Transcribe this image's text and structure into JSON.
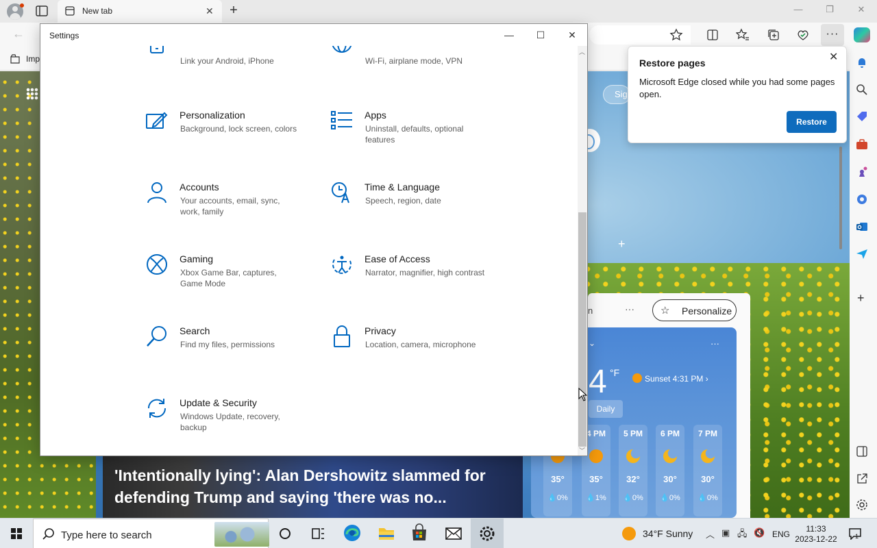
{
  "browser": {
    "tab_title": "New tab",
    "favorites_import_label": "Imp",
    "sign_in_partial": "Sig",
    "personalize_label": "Personalize",
    "news_headline": "'Intentionally lying': Alan Dershowitz slammed for defending Trump and saying 'there was no...",
    "weather": {
      "temp_partial": "4",
      "unit": "°F",
      "sunset": "Sunset 4:31 PM",
      "daily_label": "Daily",
      "hours": [
        {
          "time": "",
          "temp": "35°",
          "precip": "0%",
          "icon": "sun-icon"
        },
        {
          "time": "4 PM",
          "temp": "35°",
          "precip": "1%",
          "icon": "sun-icon"
        },
        {
          "time": "5 PM",
          "temp": "32°",
          "precip": "0%",
          "icon": "moon-icon"
        },
        {
          "time": "6 PM",
          "temp": "30°",
          "precip": "0%",
          "icon": "moon-icon"
        },
        {
          "time": "7 PM",
          "temp": "30°",
          "precip": "0%",
          "icon": "moon-icon"
        }
      ]
    }
  },
  "restore_popup": {
    "title": "Restore pages",
    "message": "Microsoft Edge closed while you had some pages open.",
    "button": "Restore"
  },
  "settings": {
    "window_title": "Settings",
    "tiles": [
      {
        "id": "phone",
        "name": "",
        "desc": "Link your Android, iPhone",
        "icon": "phone-icon"
      },
      {
        "id": "network",
        "name": "",
        "desc": "Wi-Fi, airplane mode, VPN",
        "icon": "globe-icon"
      },
      {
        "id": "personalization",
        "name": "Personalization",
        "desc": "Background, lock screen, colors",
        "icon": "personalization-icon"
      },
      {
        "id": "apps",
        "name": "Apps",
        "desc": "Uninstall, defaults, optional features",
        "icon": "apps-icon"
      },
      {
        "id": "accounts",
        "name": "Accounts",
        "desc": "Your accounts, email, sync, work, family",
        "icon": "person-icon"
      },
      {
        "id": "time",
        "name": "Time & Language",
        "desc": "Speech, region, date",
        "icon": "time-language-icon"
      },
      {
        "id": "gaming",
        "name": "Gaming",
        "desc": "Xbox Game Bar, captures, Game Mode",
        "icon": "xbox-icon"
      },
      {
        "id": "ease",
        "name": "Ease of Access",
        "desc": "Narrator, magnifier, high contrast",
        "icon": "ease-of-access-icon"
      },
      {
        "id": "search",
        "name": "Search",
        "desc": "Find my files, permissions",
        "icon": "search-icon"
      },
      {
        "id": "privacy",
        "name": "Privacy",
        "desc": "Location, camera, microphone",
        "icon": "lock-icon"
      },
      {
        "id": "update",
        "name": "Update & Security",
        "desc": "Windows Update, recovery, backup",
        "icon": "sync-icon"
      }
    ]
  },
  "taskbar": {
    "search_placeholder": "Type here to search",
    "weather": "34°F  Sunny",
    "language": "ENG",
    "time": "11:33",
    "date": "2023-12-22",
    "notification_count": "1"
  },
  "colors": {
    "accent": "#0078d4",
    "icon_blue": "#0067c0",
    "restore_button": "#0f6cbd"
  }
}
